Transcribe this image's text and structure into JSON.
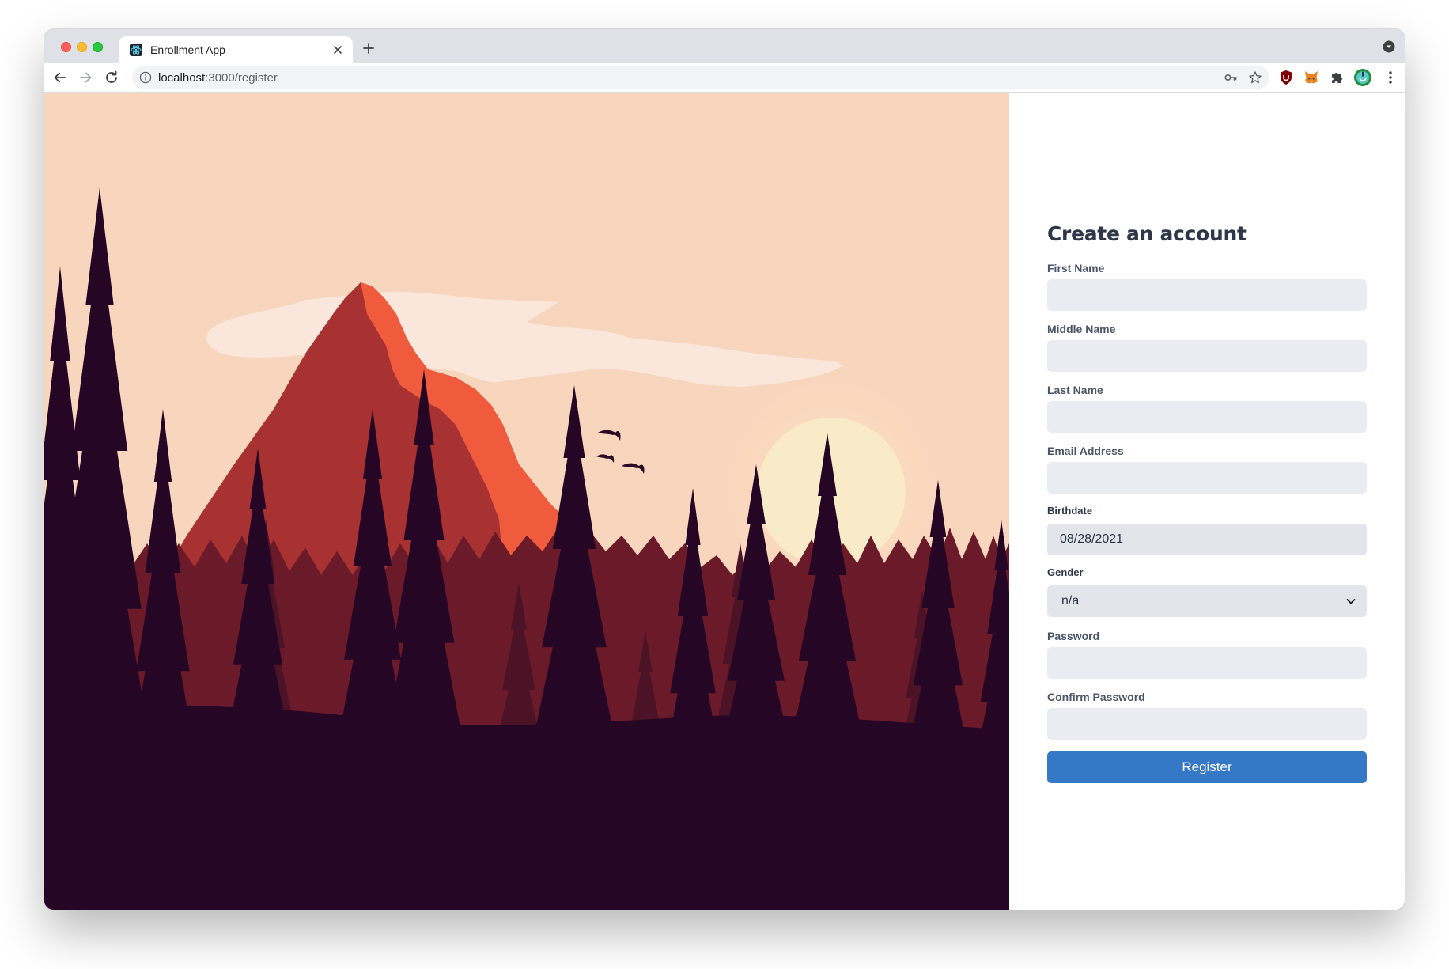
{
  "browser": {
    "tab_title": "Enrollment App",
    "url_host": "localhost",
    "url_path": ":3000/register",
    "icons": {
      "favicon": "react-logo-icon",
      "close": "close-icon",
      "new_tab": "plus-icon",
      "profile_menu": "chevron-down-circle-icon",
      "back": "arrow-left-icon",
      "forward": "arrow-right-icon",
      "reload": "reload-icon",
      "site_info": "info-icon",
      "key": "key-icon",
      "bookmark": "star-icon",
      "extensions": [
        "ublock-shield-icon",
        "metamask-fox-icon",
        "puzzle-icon",
        "profile-avatar-icon"
      ],
      "menu": "kebab-menu-icon"
    }
  },
  "hero": {
    "description_icon": "mountain-forest-sunset-illustration",
    "colors": {
      "sky": "#f8d5bd",
      "mountain": "#a83232",
      "mountain_light": "#ef5b3c",
      "clouds": "#fae6db",
      "sun": "#f9e9c1",
      "forest_far": "#6b1a2a",
      "forest_near": "#260625"
    }
  },
  "form": {
    "title": "Create an account",
    "fields": {
      "first_name": {
        "label": "First Name",
        "value": ""
      },
      "middle_name": {
        "label": "Middle Name",
        "value": ""
      },
      "last_name": {
        "label": "Last Name",
        "value": ""
      },
      "email": {
        "label": "Email Address",
        "value": ""
      },
      "birthdate": {
        "label": "Birthdate",
        "value": "08/28/2021"
      },
      "gender": {
        "label": "Gender",
        "value": "n/a"
      },
      "password": {
        "label": "Password",
        "value": ""
      },
      "confirm_password": {
        "label": "Confirm Password",
        "value": ""
      }
    },
    "submit_label": "Register",
    "colors": {
      "button": "#3578c6",
      "input_bg": "#e9ecf0",
      "title": "#2d3748"
    }
  }
}
